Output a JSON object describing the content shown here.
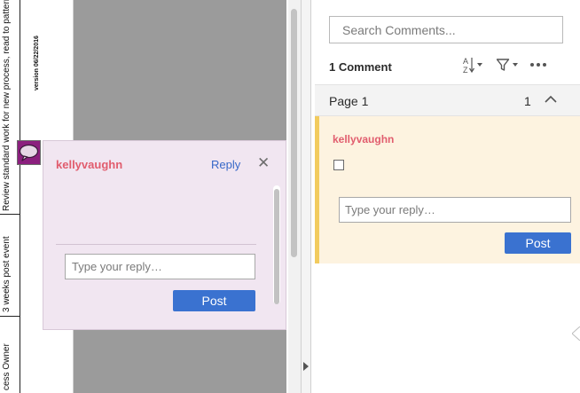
{
  "document": {
    "task_text": "Review standard work for new process, read to pattern, report safety issues",
    "version_text": "version 06/22/2016",
    "timing_text": "3 weeks post event",
    "owner_text": "cess Owner"
  },
  "popup": {
    "author": "kellyvaughn",
    "reply_label": "Reply",
    "close_symbol": "✕",
    "reply_placeholder": "Type your reply…",
    "post_label": "Post"
  },
  "comments_panel": {
    "search_placeholder": "Search Comments...",
    "count_label": "1 Comment",
    "page_label": "Page 1",
    "page_comment_count": "1",
    "comment": {
      "author": "kellyvaughn",
      "reply_placeholder": "Type your reply…",
      "post_label": "Post"
    }
  },
  "icons": {
    "note": "sticky-note-icon",
    "sort": "sort-az-icon",
    "filter": "filter-icon",
    "more": "more-options-icon",
    "chevron": "chevron-up-icon",
    "collapse": "collapse-panel-icon"
  },
  "colors": {
    "author": "#e15d6e",
    "accent": "#3a72d0",
    "popup_bg": "#f1e6f1",
    "card_bg": "#fdf3e0",
    "card_stripe": "#f2cb5e",
    "note_icon": "#8b1f7e"
  }
}
